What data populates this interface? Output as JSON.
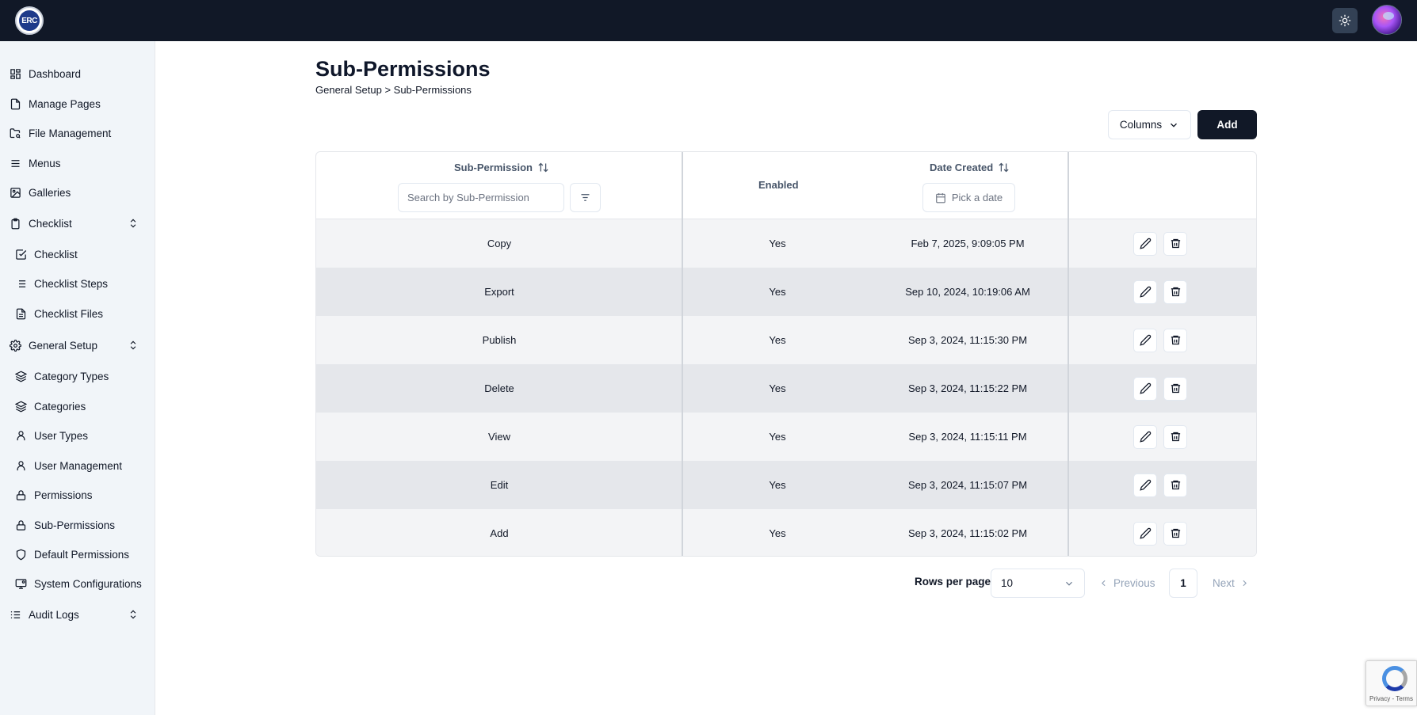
{
  "app": {
    "logo_text": "ERC"
  },
  "sidebar": {
    "items": [
      {
        "label": "Dashboard",
        "icon": "dashboard-icon"
      },
      {
        "label": "Manage Pages",
        "icon": "file-icon"
      },
      {
        "label": "File Management",
        "icon": "folder-search-icon"
      },
      {
        "label": "Menus",
        "icon": "menu-icon"
      },
      {
        "label": "Galleries",
        "icon": "image-icon"
      },
      {
        "label": "Checklist",
        "icon": "clipboard-icon",
        "expandable": true
      },
      {
        "label": "Checklist",
        "icon": "check-square-icon"
      },
      {
        "label": "Checklist Steps",
        "icon": "list-icon"
      },
      {
        "label": "Checklist Files",
        "icon": "file-text-icon"
      },
      {
        "label": "General Setup",
        "icon": "gear-icon",
        "expandable": true
      },
      {
        "label": "Category Types",
        "icon": "layers-icon"
      },
      {
        "label": "Categories",
        "icon": "layers-icon"
      },
      {
        "label": "User Types",
        "icon": "user-icon"
      },
      {
        "label": "User Management",
        "icon": "user-icon"
      },
      {
        "label": "Permissions",
        "icon": "lock-icon"
      },
      {
        "label": "Sub-Permissions",
        "icon": "lock-icon"
      },
      {
        "label": "Default Permissions",
        "icon": "shield-icon"
      },
      {
        "label": "System Configurations",
        "icon": "monitor-gear-icon"
      },
      {
        "label": "Audit Logs",
        "icon": "list-checks-icon",
        "expandable": true
      }
    ]
  },
  "page": {
    "title": "Sub-Permissions",
    "breadcrumb": "General Setup > Sub-Permissions"
  },
  "toolbar": {
    "columns_label": "Columns",
    "add_label": "Add"
  },
  "table": {
    "headers": {
      "name": "Sub-Permission",
      "enabled": "Enabled",
      "date": "Date Created"
    },
    "search_placeholder": "Search by Sub-Permission",
    "date_placeholder": "Pick a date",
    "rows": [
      {
        "name": "Copy",
        "enabled": "Yes",
        "date": "Feb 7, 2025, 9:09:05 PM"
      },
      {
        "name": "Export",
        "enabled": "Yes",
        "date": "Sep 10, 2024, 10:19:06 AM"
      },
      {
        "name": "Publish",
        "enabled": "Yes",
        "date": "Sep 3, 2024, 11:15:30 PM"
      },
      {
        "name": "Delete",
        "enabled": "Yes",
        "date": "Sep 3, 2024, 11:15:22 PM"
      },
      {
        "name": "View",
        "enabled": "Yes",
        "date": "Sep 3, 2024, 11:15:11 PM"
      },
      {
        "name": "Edit",
        "enabled": "Yes",
        "date": "Sep 3, 2024, 11:15:07 PM"
      },
      {
        "name": "Add",
        "enabled": "Yes",
        "date": "Sep 3, 2024, 11:15:02 PM"
      }
    ]
  },
  "pagination": {
    "rows_per_page_label": "Rows per page",
    "rows_per_page_value": "10",
    "previous_label": "Previous",
    "current_page": "1",
    "next_label": "Next"
  },
  "recaptcha": {
    "footer": "Privacy - Terms"
  },
  "colors": {
    "topbar": "#111827",
    "sidebar_bg": "#f1f5f9",
    "primary_button": "#111827",
    "row_alt": "#e5e7eb"
  }
}
